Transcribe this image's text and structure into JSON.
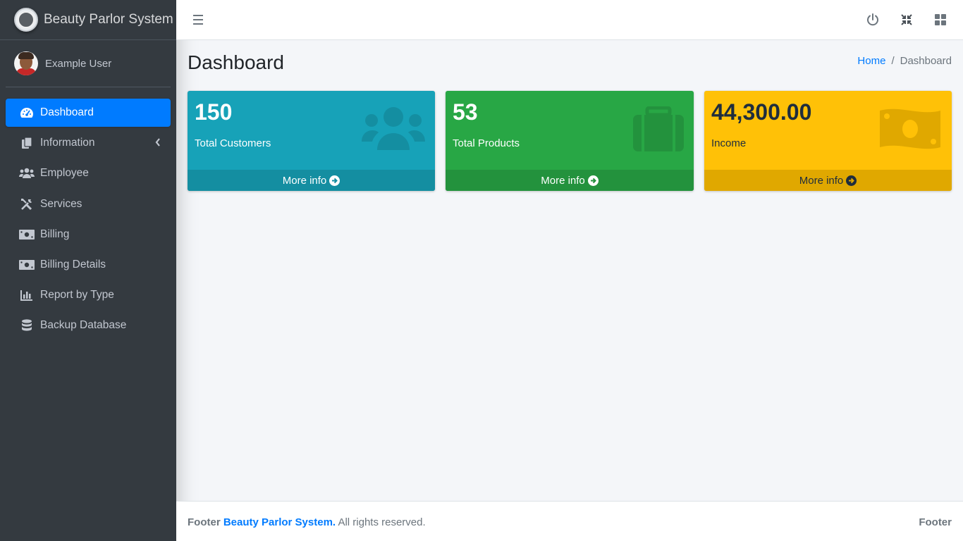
{
  "brand": {
    "title": "Beauty Parlor System"
  },
  "user": {
    "name": "Example User"
  },
  "sidebar": {
    "items": [
      {
        "label": "Dashboard",
        "icon": "tachometer-icon",
        "active": true
      },
      {
        "label": "Information",
        "icon": "copy-icon",
        "has_submenu": true
      },
      {
        "label": "Employee",
        "icon": "users-icon"
      },
      {
        "label": "Services",
        "icon": "tools-icon"
      },
      {
        "label": "Billing",
        "icon": "money-bill-icon"
      },
      {
        "label": "Billing Details",
        "icon": "money-bill-icon"
      },
      {
        "label": "Report by Type",
        "icon": "chart-bar-icon"
      },
      {
        "label": "Backup Database",
        "icon": "database-icon"
      }
    ]
  },
  "header": {
    "icons": [
      "menu-icon",
      "power-icon",
      "compress-icon",
      "th-large-icon"
    ]
  },
  "page": {
    "title": "Dashboard"
  },
  "breadcrumb": {
    "home": "Home",
    "sep": "/",
    "current": "Dashboard"
  },
  "cards": [
    {
      "value": "150",
      "label": "Total Customers",
      "more": "More info",
      "icon": "users-icon",
      "color": "#17a2b8"
    },
    {
      "value": "53",
      "label": "Total Products",
      "more": "More info",
      "icon": "briefcase-icon",
      "color": "#28a745"
    },
    {
      "value": "44,300.00",
      "label": "Income",
      "more": "More info",
      "icon": "money-bill-icon",
      "color": "#ffc107"
    }
  ],
  "footer": {
    "prefix": "Footer",
    "brand": "Beauty Parlor System.",
    "suffix": "All rights reserved.",
    "right": "Footer"
  }
}
